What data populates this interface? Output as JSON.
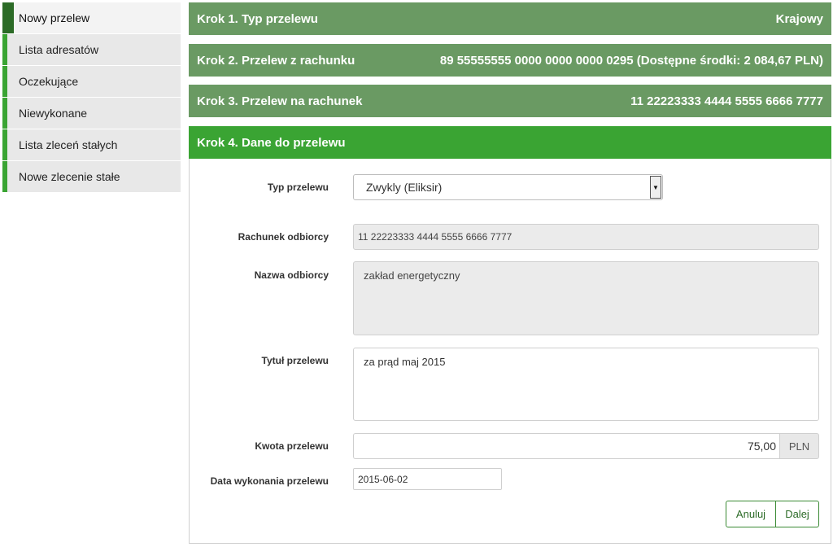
{
  "sidebar": {
    "items": [
      {
        "label": "Nowy przelew"
      },
      {
        "label": "Lista adresatów"
      },
      {
        "label": "Oczekujące"
      },
      {
        "label": "Niewykonane"
      },
      {
        "label": "Lista zleceń stałych"
      },
      {
        "label": "Nowe zlecenie stałe"
      }
    ]
  },
  "steps": [
    {
      "title": "Krok 1. Typ przelewu",
      "value": "Krajowy"
    },
    {
      "title": "Krok 2. Przelew z rachunku",
      "value": "89 55555555 0000 0000 0000 0295 (Dostępne środki: 2 084,67 PLN)"
    },
    {
      "title": "Krok 3. Przelew na rachunek",
      "value": "11 22223333 4444 5555 6666 7777"
    },
    {
      "title": "Krok 4. Dane do przelewu"
    }
  ],
  "form": {
    "transfer_type": {
      "label": "Typ przelewu",
      "value": "Zwykly (Eliksir)"
    },
    "recipient_account": {
      "label": "Rachunek odbiorcy",
      "value": "11 22223333 4444 5555 6666 7777"
    },
    "recipient_name": {
      "label": "Nazwa odbiorcy",
      "value": "zakład energetyczny"
    },
    "title": {
      "label": "Tytuł przelewu",
      "value": "za prąd maj 2015"
    },
    "amount": {
      "label": "Kwota przelewu",
      "value": "75,00",
      "currency": "PLN"
    },
    "date": {
      "label": "Data wykonania przelewu",
      "value": "2015-06-02"
    }
  },
  "buttons": {
    "cancel": "Anuluj",
    "next": "Dalej"
  },
  "colors": {
    "accent": "#3aa433",
    "step_done": "#6a9a63",
    "active_marker": "#2c6b27"
  },
  "icons": {
    "select_arrow": "triangle-down-icon"
  }
}
